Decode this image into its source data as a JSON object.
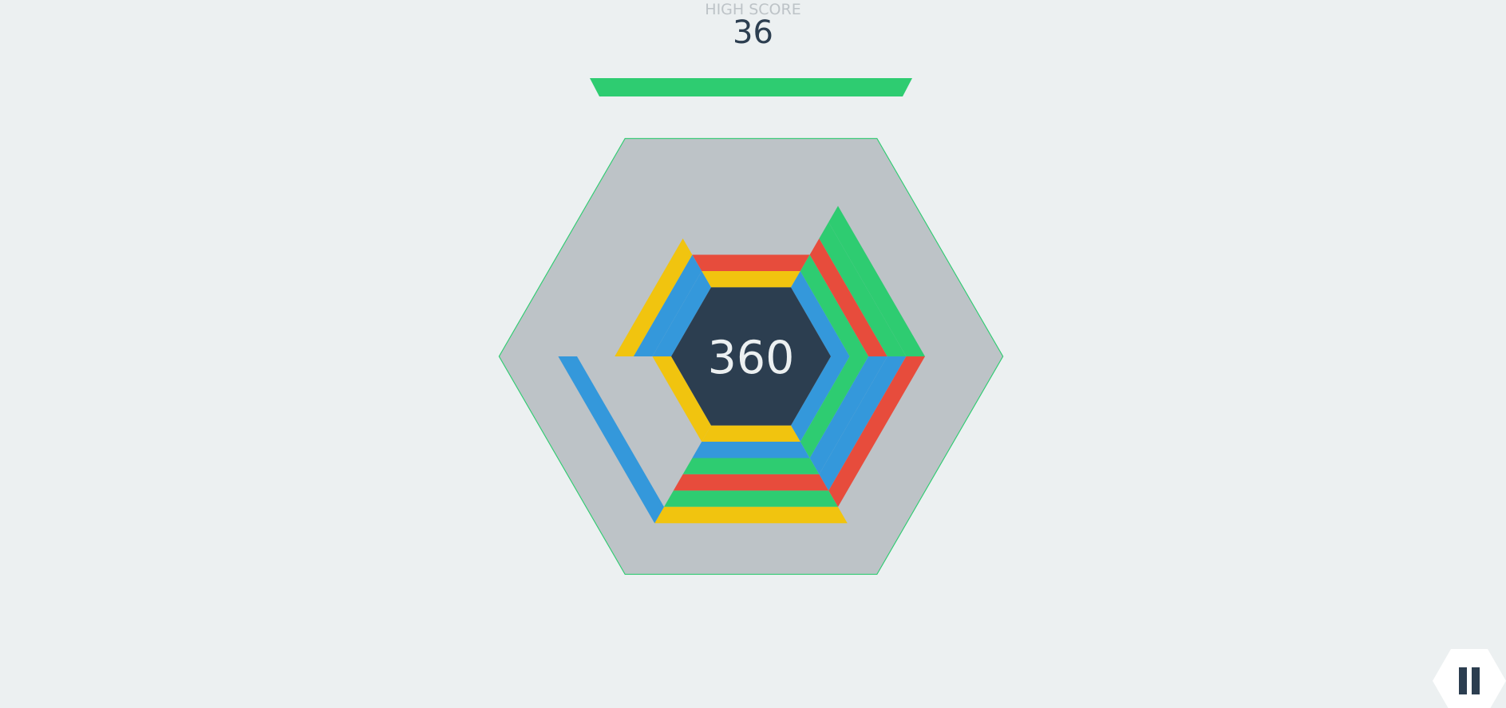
{
  "high_score": {
    "label": "HIGH SCORE",
    "value": "36"
  },
  "score": "360",
  "timer_bar": {
    "fraction_remaining": 1.0,
    "color": "#2ecc71"
  },
  "colors": {
    "red": "#e74c3c",
    "yellow": "#f1c40f",
    "blue": "#3498db",
    "green": "#2ecc71",
    "board": "#bdc3c7",
    "center": "#2c3e50",
    "outline": "#2ecc71",
    "background": "#ecf0f1"
  },
  "stacks": [
    {
      "side": "top",
      "blocks": [
        "yellow",
        "red"
      ]
    },
    {
      "side": "upper-right",
      "blocks": [
        "blue",
        "green",
        "red",
        "green",
        "green"
      ]
    },
    {
      "side": "lower-right",
      "blocks": [
        "blue",
        "green",
        "blue",
        "blue",
        "red"
      ]
    },
    {
      "side": "bottom",
      "blocks": [
        "yellow",
        "blue",
        "green",
        "red",
        "green",
        "yellow"
      ]
    },
    {
      "side": "lower-left",
      "blocks": [
        "yellow"
      ],
      "falling": [
        {
          "color": "blue",
          "level": 5
        }
      ]
    },
    {
      "side": "upper-left",
      "blocks": [
        "blue",
        "blue",
        "yellow"
      ]
    }
  ],
  "pause_button": {
    "icon": "pause-icon"
  }
}
